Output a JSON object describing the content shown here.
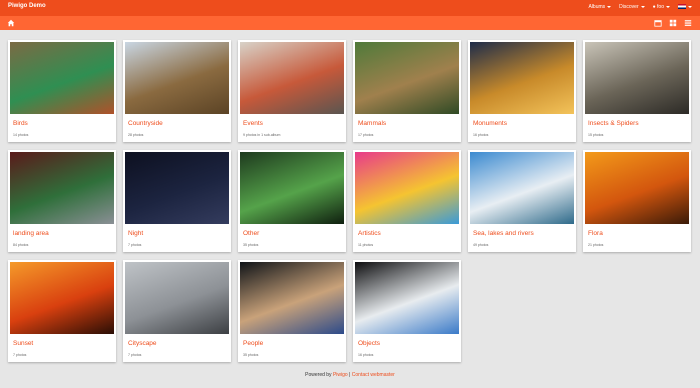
{
  "nav": {
    "brand": "Piwigo Demo",
    "menu": [
      {
        "label": "Albums"
      },
      {
        "label": "Discover"
      },
      {
        "label": "foo"
      }
    ]
  },
  "albums": [
    {
      "title": "Birds",
      "count": "14 photos",
      "colors": [
        "#7b6a44",
        "#2f8f52",
        "#b0512a"
      ]
    },
    {
      "title": "Countryside",
      "count": "28 photos",
      "colors": [
        "#c9d6e3",
        "#8a6a40",
        "#5b4325"
      ]
    },
    {
      "title": "Events",
      "count": "9 photos in 1 sub-album",
      "colors": [
        "#d8d2c8",
        "#c7593a",
        "#5a5550"
      ]
    },
    {
      "title": "Mammals",
      "count": "17 photos",
      "colors": [
        "#4f7a3a",
        "#a0804d",
        "#2f4a25"
      ]
    },
    {
      "title": "Monuments",
      "count": "16 photos",
      "colors": [
        "#1e2c4a",
        "#c88a2a",
        "#f3c35a"
      ]
    },
    {
      "title": "Insects & Spiders",
      "count": "15 photos",
      "colors": [
        "#c9c4b8",
        "#6b6558",
        "#2c2a26"
      ]
    },
    {
      "title": "landing area",
      "count": "84 photos",
      "colors": [
        "#5a1a1a",
        "#2f6f3a",
        "#8a8f95"
      ]
    },
    {
      "title": "Night",
      "count": "7 photos",
      "colors": [
        "#0d1020",
        "#1c2440",
        "#343c5e"
      ]
    },
    {
      "title": "Other",
      "count": "35 photos",
      "colors": [
        "#1e3a1e",
        "#55a34a",
        "#0f1f0f"
      ]
    },
    {
      "title": "Artistics",
      "count": "11 photos",
      "colors": [
        "#e83a8a",
        "#f5c431",
        "#3a9ad8"
      ]
    },
    {
      "title": "Sea, lakes and rivers",
      "count": "49 photos",
      "colors": [
        "#3b8ad0",
        "#e8eef3",
        "#2e6a8a"
      ]
    },
    {
      "title": "Flora",
      "count": "21 photos",
      "colors": [
        "#f39a1a",
        "#d3560e",
        "#3a1a08"
      ]
    },
    {
      "title": "Sunset",
      "count": "7 photos",
      "colors": [
        "#f59a2a",
        "#d9400f",
        "#2a0e05"
      ]
    },
    {
      "title": "Cityscape",
      "count": "7 photos",
      "colors": [
        "#bfc3c7",
        "#8d9196",
        "#3c3f43"
      ]
    },
    {
      "title": "People",
      "count": "35 photos",
      "colors": [
        "#101418",
        "#c9a27a",
        "#2c4a8a"
      ]
    },
    {
      "title": "Objects",
      "count": "16 photos",
      "colors": [
        "#0e0e10",
        "#e8ecef",
        "#3a7ac8"
      ]
    }
  ],
  "footer": {
    "prefix": "Powered by",
    "piwigo_link": "Piwigo",
    "separator": "|",
    "contact_link": "Contact webmaster"
  }
}
